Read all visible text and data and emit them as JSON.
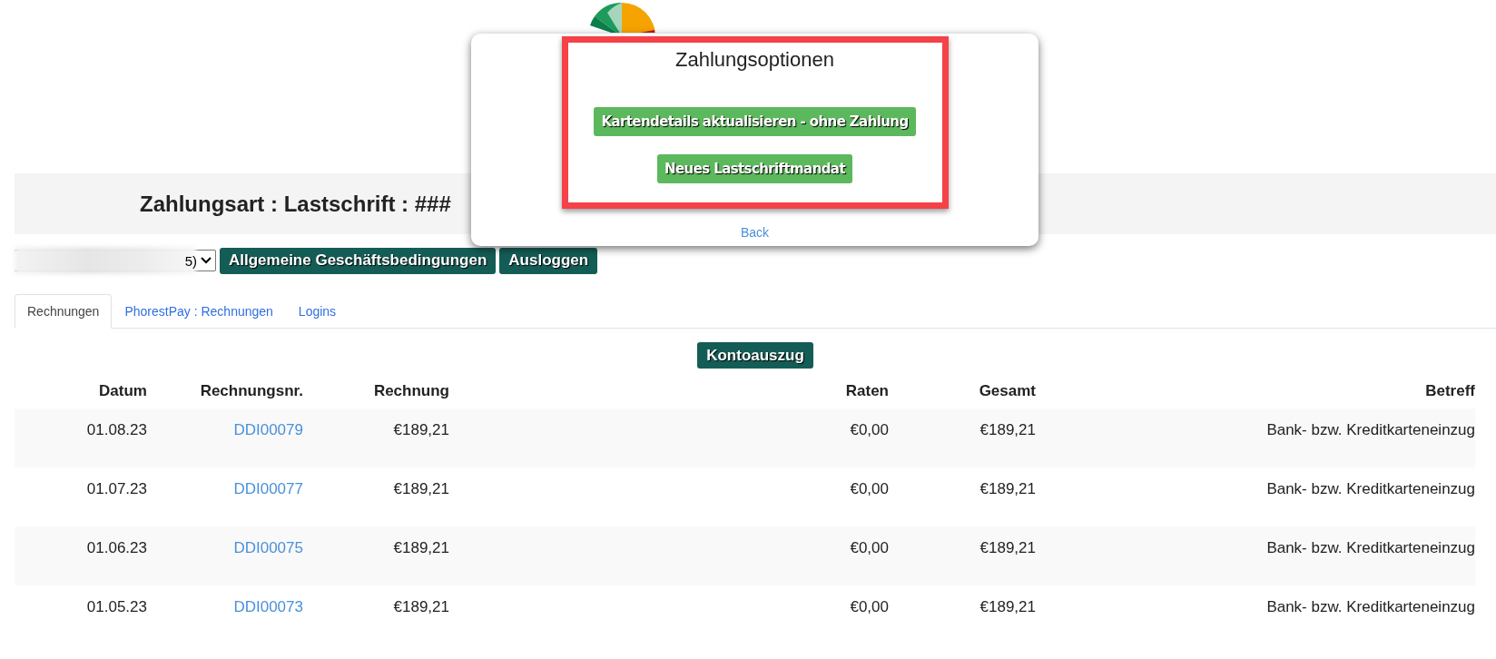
{
  "modal": {
    "title": "Zahlungsoptionen",
    "buttons": [
      "Kartendetails aktualisieren - ohne Zahlung",
      "Neues Lastschriftmandat"
    ],
    "back_link": "Back"
  },
  "header": {
    "title": "Zahlungsart : Lastschrift : ###"
  },
  "account_select": {
    "value": "5)"
  },
  "buttons": [
    "Allgemeine Geschäftsbedingungen",
    "Ausloggen"
  ],
  "tabs": [
    {
      "label": "Rechnungen",
      "selected": true
    },
    {
      "label": "PhorestPay : Rechnungen",
      "selected": false
    },
    {
      "label": "Logins",
      "selected": false
    }
  ],
  "statement_button": "Kontoauszug",
  "table": {
    "columns": [
      "Datum",
      "Rechnungsnr.",
      "Rechnung",
      "Raten",
      "Gesamt",
      "Betreff"
    ],
    "rows": [
      [
        "01.08.23",
        "DDI00079",
        "€189,21",
        "€0,00",
        "€189,21",
        "Bank- bzw. Kreditkarteneinzug"
      ],
      [
        "01.07.23",
        "DDI00077",
        "€189,21",
        "€0,00",
        "€189,21",
        "Bank- bzw. Kreditkarteneinzug"
      ],
      [
        "01.06.23",
        "DDI00075",
        "€189,21",
        "€0,00",
        "€189,21",
        "Bank- bzw. Kreditkarteneinzug"
      ],
      [
        "01.05.23",
        "DDI00073",
        "€189,21",
        "€0,00",
        "€189,21",
        "Bank- bzw. Kreditkarteneinzug"
      ]
    ]
  }
}
